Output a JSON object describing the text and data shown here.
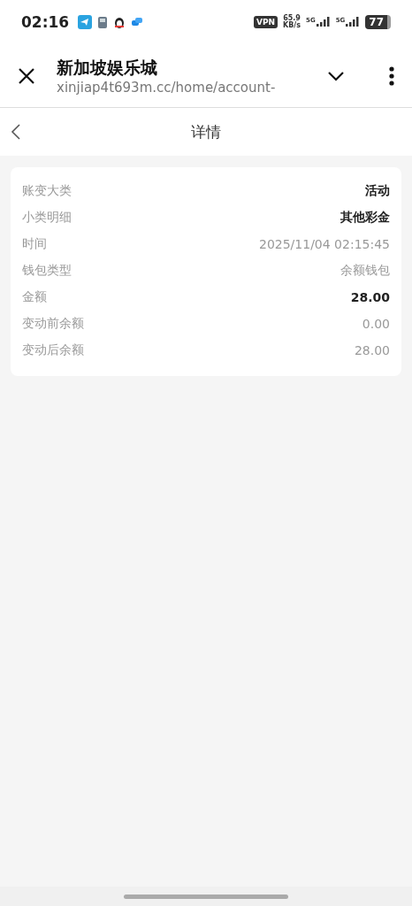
{
  "status_bar": {
    "time": "02:16",
    "vpn": "VPN",
    "speed": "65.9",
    "speed_unit": "KB/s",
    "networks": [
      "5G",
      "5G"
    ],
    "battery": "77"
  },
  "browser": {
    "title": "新加坡娱乐城",
    "url": "xinjiap4t693m.cc/home/account-"
  },
  "header": {
    "title": "详情"
  },
  "details": [
    {
      "label": "账变大类",
      "value": "活动",
      "emphasized": true
    },
    {
      "label": "小类明细",
      "value": "其他彩金",
      "emphasized": true
    },
    {
      "label": "时间",
      "value": "2025/11/04 02:15:45",
      "emphasized": false
    },
    {
      "label": "钱包类型",
      "value": "余额钱包",
      "emphasized": false
    },
    {
      "label": "金额",
      "value": "28.00",
      "emphasized": true
    },
    {
      "label": "变动前余额",
      "value": "0.00",
      "emphasized": false
    },
    {
      "label": "变动后余额",
      "value": "28.00",
      "emphasized": false
    }
  ]
}
